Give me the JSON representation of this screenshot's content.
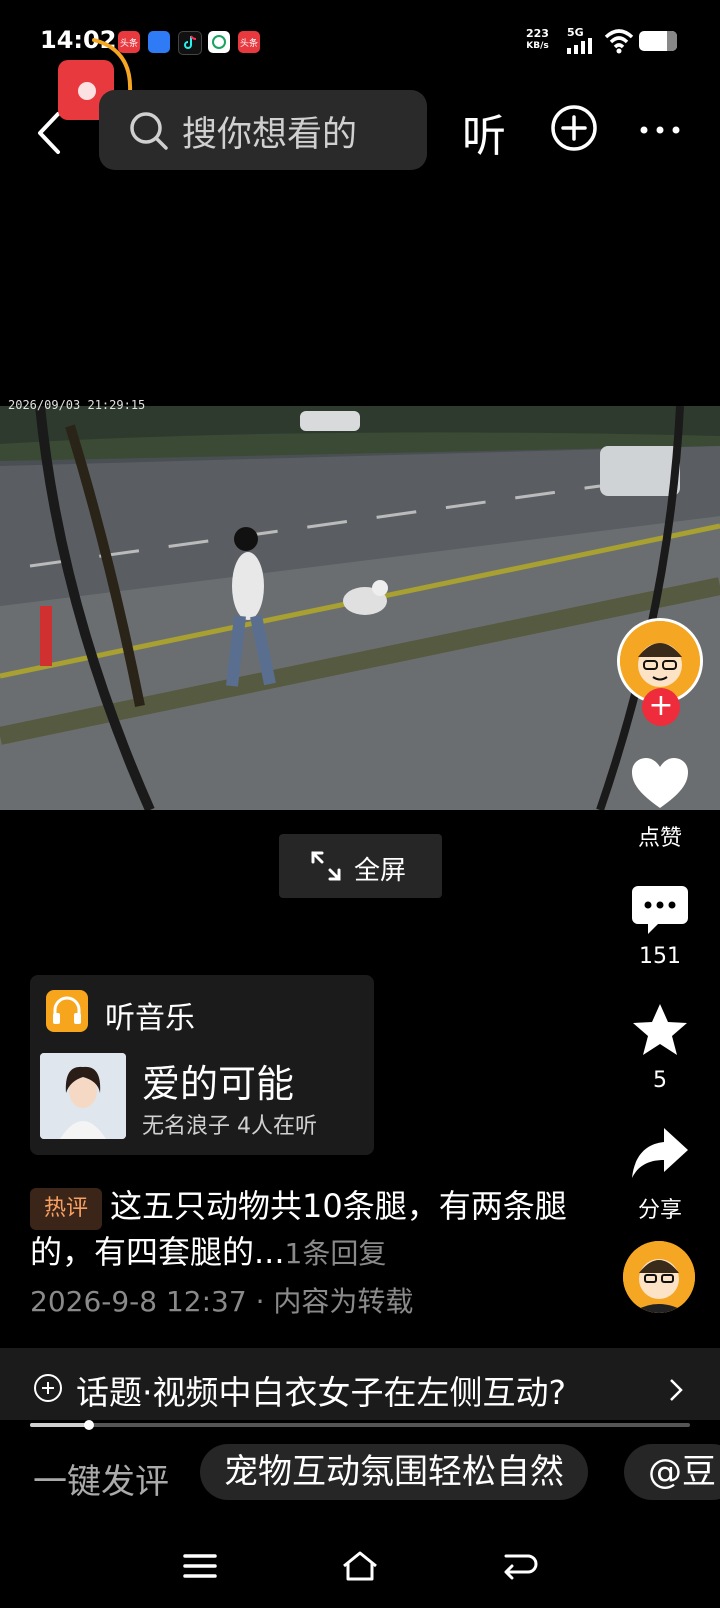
{
  "status_bar": {
    "time": "14:02",
    "notification_apps": [
      "头条",
      "app",
      "douyin",
      "wallet",
      "头条"
    ],
    "net_speed": "223",
    "net_speed_unit": "KB/s",
    "network": "5G"
  },
  "header": {
    "search_placeholder": "搜你想看的",
    "listen_label": "听"
  },
  "video": {
    "timestamp": "2026/09/03 21:29:15",
    "fullscreen_label": "全屏"
  },
  "rail": {
    "like_label": "点赞",
    "comment_count": "151",
    "favorite_count": "5",
    "share_label": "分享",
    "follow_symbol": "+"
  },
  "music": {
    "title": "听音乐",
    "song_name": "爱的可能",
    "song_sub": "无名浪子 4人在听"
  },
  "comment": {
    "tag": "热评",
    "text": "这五只动物共10条腿，有两条腿的，有四套腿的...",
    "reply_count": "1条回复",
    "date_line": "2026-9-8 12:37 · 内容为转载"
  },
  "topic": {
    "text": "话题·视频中白衣女子在左侧互动?",
    "progress": 0.09
  },
  "quick_reply": {
    "label": "一键发评",
    "chips": [
      "宠物互动氛围轻松自然",
      "@豆"
    ]
  },
  "colors": {
    "accent_red": "#ee2c3c",
    "music_orange": "#f7a51c",
    "hot_tag_text": "#f7a062"
  }
}
